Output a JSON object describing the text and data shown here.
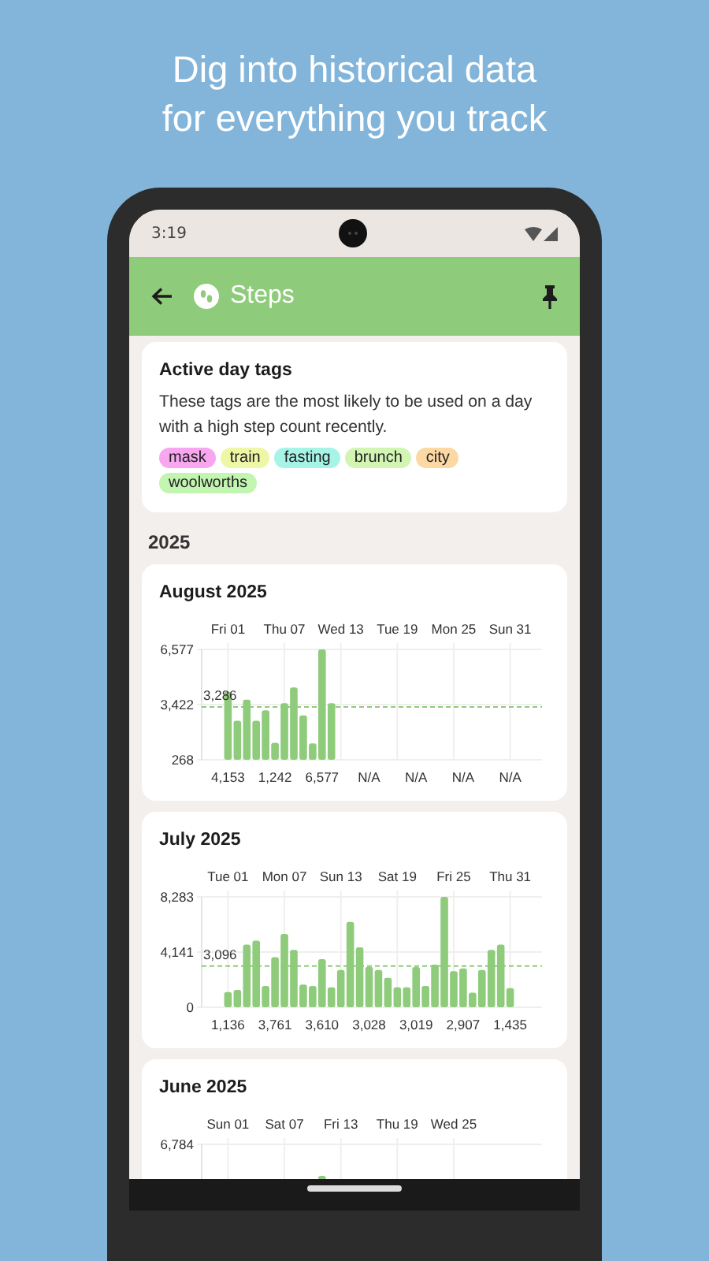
{
  "headline": [
    "Dig into historical data",
    "for everything you track"
  ],
  "status_bar": {
    "time": "3:19"
  },
  "app_bar": {
    "title": "Steps"
  },
  "tags_card": {
    "title": "Active day tags",
    "description": "These tags are the most likely to be used on a day with a high step count recently.",
    "tags": [
      {
        "label": "mask",
        "color": "#f7a6ef"
      },
      {
        "label": "train",
        "color": "#eef7a6"
      },
      {
        "label": "fasting",
        "color": "#a6f4e6"
      },
      {
        "label": "brunch",
        "color": "#d2f5b4"
      },
      {
        "label": "city",
        "color": "#fbd8a4"
      },
      {
        "label": "woolworths",
        "color": "#c2f5b0"
      }
    ]
  },
  "year_heading": "2025",
  "months": [
    {
      "title": "August 2025",
      "chart_data": {
        "type": "bar",
        "categories": [
          "Fri 01",
          null,
          null,
          null,
          null,
          null,
          "Thu 07",
          null,
          null,
          null,
          null,
          null,
          "Wed 13",
          null,
          null,
          null,
          null,
          null,
          "Tue 19",
          null,
          null,
          null,
          null,
          null,
          "Mon 25",
          null,
          null,
          null,
          null,
          null,
          "Sun 31"
        ],
        "values": [
          4153,
          2500,
          3700,
          2500,
          3100,
          1242,
          3500,
          4400,
          2800,
          1200,
          6577,
          3500,
          null,
          null,
          null,
          null,
          null,
          null,
          null,
          null,
          null,
          null,
          null,
          null,
          null,
          null,
          null,
          null,
          null,
          null,
          null
        ],
        "ylim": [
          268,
          6577
        ],
        "yticks": [
          {
            "value": 6577,
            "label": "6,577"
          },
          {
            "value": 3422,
            "label": "3,422"
          },
          {
            "value": 268,
            "label": "268"
          }
        ],
        "value_labels": [
          "4,153",
          null,
          null,
          null,
          null,
          "1,242",
          null,
          null,
          null,
          null,
          "6,577",
          null,
          null,
          null,
          null,
          "N/A",
          null,
          null,
          null,
          null,
          "N/A",
          null,
          null,
          null,
          null,
          "N/A",
          null,
          null,
          null,
          null,
          "N/A"
        ],
        "grid": true,
        "ref_lines": [
          {
            "axis": "y",
            "value": 3286,
            "label": "3,286"
          }
        ]
      }
    },
    {
      "title": "July 2025",
      "chart_data": {
        "type": "bar",
        "categories": [
          "Tue 01",
          null,
          null,
          null,
          null,
          null,
          "Mon 07",
          null,
          null,
          null,
          null,
          null,
          "Sun 13",
          null,
          null,
          null,
          null,
          null,
          "Sat 19",
          null,
          null,
          null,
          null,
          null,
          "Fri 25",
          null,
          null,
          null,
          null,
          null,
          "Thu 31"
        ],
        "values": [
          1136,
          1300,
          4700,
          5000,
          1600,
          3761,
          5500,
          4300,
          1700,
          1600,
          3610,
          1500,
          2800,
          6400,
          4500,
          3028,
          2800,
          2200,
          1500,
          1500,
          3019,
          1600,
          3200,
          8283,
          2700,
          2907,
          1100,
          2800,
          4300,
          4700,
          1435
        ],
        "ylim": [
          0,
          8283
        ],
        "yticks": [
          {
            "value": 8283,
            "label": "8,283"
          },
          {
            "value": 4141,
            "label": "4,141"
          },
          {
            "value": 0,
            "label": "0"
          }
        ],
        "value_labels": [
          "1,136",
          null,
          null,
          null,
          null,
          "3,761",
          null,
          null,
          null,
          null,
          "3,610",
          null,
          null,
          null,
          null,
          "3,028",
          null,
          null,
          null,
          null,
          "3,019",
          null,
          null,
          null,
          null,
          "2,907",
          null,
          null,
          null,
          null,
          "1,435"
        ],
        "grid": true,
        "ref_lines": [
          {
            "axis": "y",
            "value": 3096,
            "label": "3,096"
          }
        ]
      }
    }
  ],
  "partial_month": {
    "title": "June 2025",
    "date_labels": [
      "Sun 01",
      "Sat 07",
      "Fri 13",
      "Thu 19",
      "Wed 25"
    ],
    "top_label": "6,784"
  }
}
